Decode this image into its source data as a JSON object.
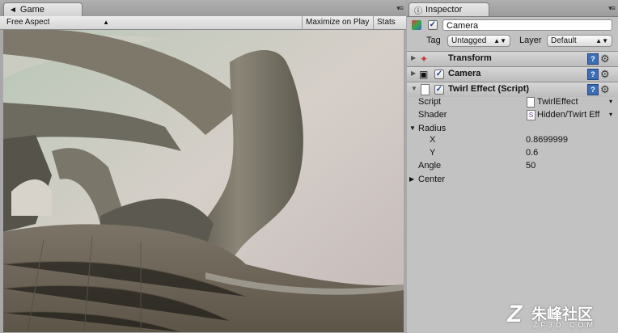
{
  "game": {
    "tab_label": "Game",
    "aspect": "Free Aspect",
    "maximize_label": "Maximize on Play",
    "stats_label": "Stats"
  },
  "inspector": {
    "tab_label": "Inspector",
    "object": {
      "name": "Camera",
      "active": true,
      "tag_label": "Tag",
      "tag_value": "Untagged",
      "layer_label": "Layer",
      "layer_value": "Default"
    },
    "components": {
      "transform": {
        "title": "Transform"
      },
      "camera": {
        "title": "Camera",
        "enabled": true
      },
      "twirl": {
        "title": "Twirl Effect (Script)",
        "enabled": true,
        "script_label": "Script",
        "script_value": "TwirlEffect",
        "shader_label": "Shader",
        "shader_value": "Hidden/Twirt Eff",
        "radius_label": "Radius",
        "x_label": "X",
        "x_value": "0.8699999",
        "y_label": "Y",
        "y_value": "0.6",
        "angle_label": "Angle",
        "angle_value": "50",
        "center_label": "Center"
      }
    }
  },
  "watermark": {
    "brand": "朱峰社区",
    "domain": "ZF3D.COM"
  }
}
